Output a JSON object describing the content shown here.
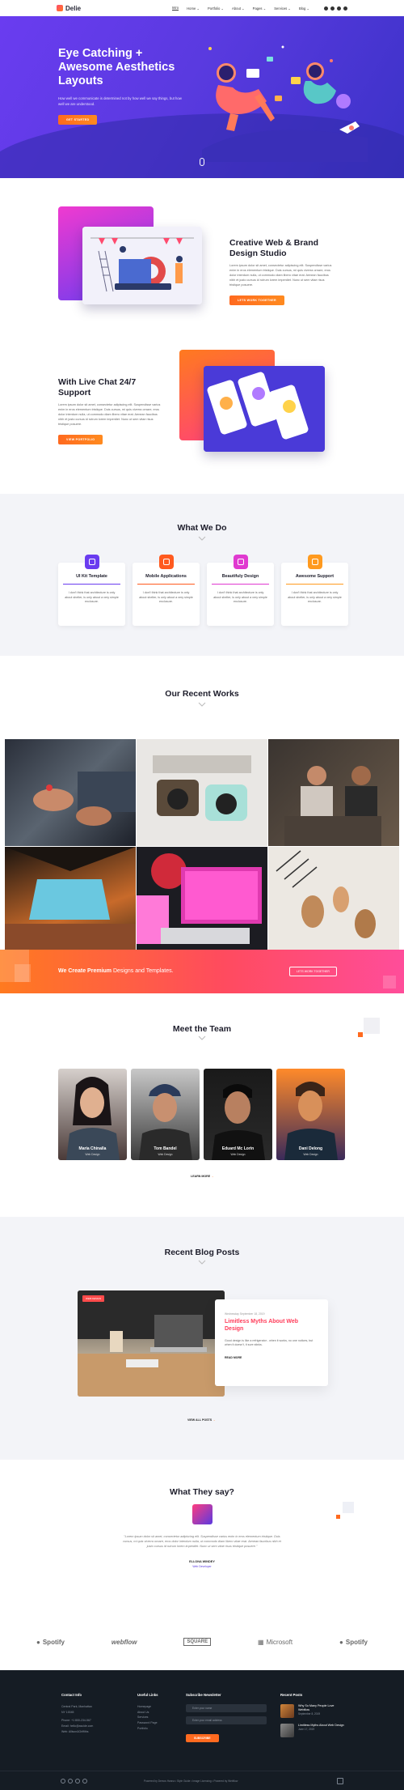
{
  "header": {
    "brand": "Delie",
    "nav": [
      {
        "label": "Intro"
      },
      {
        "label": "Home ⌄"
      },
      {
        "label": "Portfolio ⌄"
      },
      {
        "label": "About ⌄"
      },
      {
        "label": "Pages ⌄"
      },
      {
        "label": "Services ⌄"
      },
      {
        "label": "Blog ⌄"
      }
    ],
    "social_icons": [
      "facebook-icon",
      "instagram-icon",
      "dribbble-icon",
      "twitter-icon"
    ]
  },
  "hero": {
    "title": "Eye Catching + Awesome Aesthetics Layouts",
    "subtitle": "How well we communicate is determined not by how well we say things, but how well we are understood.",
    "button": "GET STARTED"
  },
  "feature1": {
    "title": "Creative Web & Brand Design Studio",
    "desc": "Lorem ipsum dolor sit amet, consectetur adipiscing elit. Suspendisse varius enim in eros elementum tristique. Duis cursus, mi quis viverra ornare, eros dolor interdum nulla, ut commodo diam libero vitae erat. Aenean faucibus nibh et justo cursus id rutrum lorem imperdiet. Nunc ut sem vitae risus tristique posuere.",
    "button": "LETS WORK TOGETHER"
  },
  "feature2": {
    "title": "With Live Chat 24/7 Support",
    "desc": "Lorem ipsum dolor sit amet, consectetur adipiscing elit. Suspendisse varius enim in eros elementum tristique. Duis cursus, mi quis viverra ornare, eros dolor interdum nulla, ut commodo diam libero vitae erat. Aenean faucibus nibh et justo cursus id rutrum lorem imperdiet. Nunc ut sem vitae risus tristique posuere.",
    "button": "VIEW PORTFOLIO"
  },
  "whatwedo": {
    "title": "What We Do",
    "cards": [
      {
        "title": "UI Kit Template",
        "desc": "I don't think that architecture is only about shelter, is only about a very simple enclosure.",
        "color": "#6a3cf0"
      },
      {
        "title": "Mobile Applications",
        "desc": "I don't think that architecture is only about shelter, is only about a very simple enclosure.",
        "color": "#ff5a1f"
      },
      {
        "title": "Beautifuly Design",
        "desc": "I don't think that architecture is only about shelter, is only about a very simple enclosure.",
        "color": "#e03ad0"
      },
      {
        "title": "Awesome Support",
        "desc": "I don't think that architecture is only about shelter, is only about a very simple enclosure.",
        "color": "#ff9a1f"
      }
    ]
  },
  "works": {
    "title": "Our Recent Works",
    "banner_strong": "We Create Premium",
    "banner_rest": " Designs and Templates.",
    "banner_button": "LETS WORK TOGETHER"
  },
  "team": {
    "title": "Meet the Team",
    "members": [
      {
        "name": "Maria Chinalla",
        "role": "Web Design"
      },
      {
        "name": "Tom Bandel",
        "role": "Web Design"
      },
      {
        "name": "Eduard Mc Lorin",
        "role": "Web Design"
      },
      {
        "name": "Dani Delong",
        "role": "Web Design"
      }
    ],
    "learn_more": "LEARN MORE"
  },
  "blog": {
    "title": "Recent Blog Posts",
    "badge": "WEB DESIGN",
    "date": "Wednesday September 18, 2019",
    "post_title": "Limitless Myths About Web Design",
    "desc": "Good design is like a refrigerator - when it works, no one notices, but when it doesn't, it sure stinks.",
    "read_more": "READ MORE",
    "view_all": "VIEW ALL POSTS"
  },
  "testimonials": {
    "title": "What They say?",
    "quote": "\"Lorem ipsum dolor sit amet, consectetur adipiscing elit. Suspendisse varius enim in eros elementum tristique. Duis cursus, mi quis viverra ornare, eros dolor interdum nulla, ut commodo diam libero vitae erat. Aenean faucibus nibh et justo cursus id rutrum lorem imperdiet. Nunc ut sem vitae risus tristique posuere.\"",
    "name": "ELLONA WINDEY",
    "role": "Web Developer"
  },
  "logos": [
    "Spotify",
    "webflow",
    "SQUARE",
    "Microsoft",
    "Spotify"
  ],
  "footer": {
    "contact_title": "Contact Info",
    "contact_lines": [
      "Central Park, Manhattan",
      "NY 10045",
      "",
      "Phone: +1 800-234-567",
      "Email: hello@ascide.com",
      "Web: Allison&Griffiths"
    ],
    "links_title": "Useful Links",
    "links": [
      "Homepage",
      "About Us",
      "Services",
      "Password Page",
      "Portfolio"
    ],
    "newsletter_title": "Subscribe Newsletter",
    "name_placeholder": "Enter your name",
    "email_placeholder": "Enter your email address",
    "subscribe": "SUBSCRIBE",
    "posts_title": "Recent Posts",
    "posts": [
      {
        "title": "Why So Many People Love Webflow",
        "date": "September 8, 2019"
      },
      {
        "title": "Limitless Myths About Web Design",
        "date": "June 17, 2019"
      }
    ],
    "copyright": "Powered by Demos Hanna • Style Guide • Image Licensing • Powered by Webflow"
  }
}
